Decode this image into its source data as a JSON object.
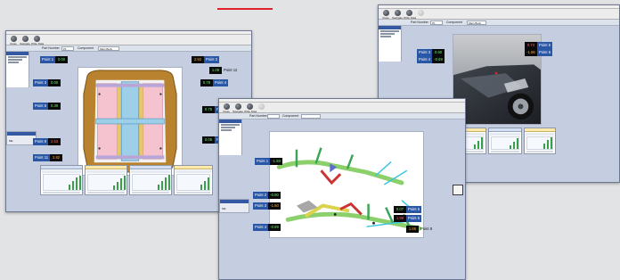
{
  "toolbar": {
    "buttons": [
      {
        "label": "Close",
        "icon": "close-circle-icon"
      },
      {
        "label": "Navigate",
        "icon": "navigate-circle-icon"
      },
      {
        "label": "Write Data",
        "icon": "write-data-circle-icon"
      }
    ]
  },
  "filter": {
    "part_number_label": "Part Number",
    "component_label": "Component",
    "part_number_value": "P1",
    "component_value": "Main Body"
  },
  "windows": {
    "left": {
      "side_value": "ME",
      "points": [
        {
          "name": "Point 1",
          "value": "0.00",
          "tone": "g"
        },
        {
          "name": "Point 2",
          "value": "2.92",
          "tone": "o"
        },
        {
          "name": "Point 3",
          "value": "0.00",
          "tone": "g"
        },
        {
          "name": "Point 4",
          "value": "0.78",
          "tone": "g"
        },
        {
          "name": "Point 5",
          "value": "0.39",
          "tone": "g"
        },
        {
          "name": "Point 6",
          "value": "0.75",
          "tone": "g"
        },
        {
          "name": "Point 9",
          "value": "2.63",
          "tone": "r"
        },
        {
          "name": "Point 10",
          "value": "0.06",
          "tone": "g"
        },
        {
          "name": "Point 11",
          "value": "2.82",
          "tone": "o"
        },
        {
          "name": "Point 12",
          "value": "1.09",
          "tone": "g"
        }
      ]
    },
    "middle": {
      "side_value": "ME",
      "points": [
        {
          "name": "Point 1",
          "value": "-1.58",
          "tone": "g"
        },
        {
          "name": "Point 2",
          "value": "-0.80",
          "tone": "g"
        },
        {
          "name": "Point 3",
          "value": "-1.50",
          "tone": "o"
        },
        {
          "name": "Point 4",
          "value": "-0.89",
          "tone": "g"
        },
        {
          "name": "Point 5",
          "value": "0.07",
          "tone": "g"
        },
        {
          "name": "Point 6",
          "value": "1.98",
          "tone": "r"
        },
        {
          "name": "Point 8",
          "value": "1.86",
          "tone": "o"
        }
      ]
    },
    "right": {
      "side_value": "ME",
      "points": [
        {
          "name": "Point 1",
          "value": "0.39",
          "tone": "g"
        },
        {
          "name": "Point 2",
          "value": "-1.34",
          "tone": "o"
        },
        {
          "name": "Point 3",
          "value": "0.60",
          "tone": "g"
        },
        {
          "name": "Point 4",
          "value": "-0.69",
          "tone": "g"
        },
        {
          "name": "Point 5",
          "value": "0.73",
          "tone": "r"
        },
        {
          "name": "Point 6",
          "value": "-1.86",
          "tone": "o"
        }
      ]
    }
  },
  "colors": {
    "accent": "#2a57a5",
    "pass": "#6fee6f",
    "fail": "#ff6262",
    "warn": "#ffab35",
    "highlight": "#e0202a"
  }
}
